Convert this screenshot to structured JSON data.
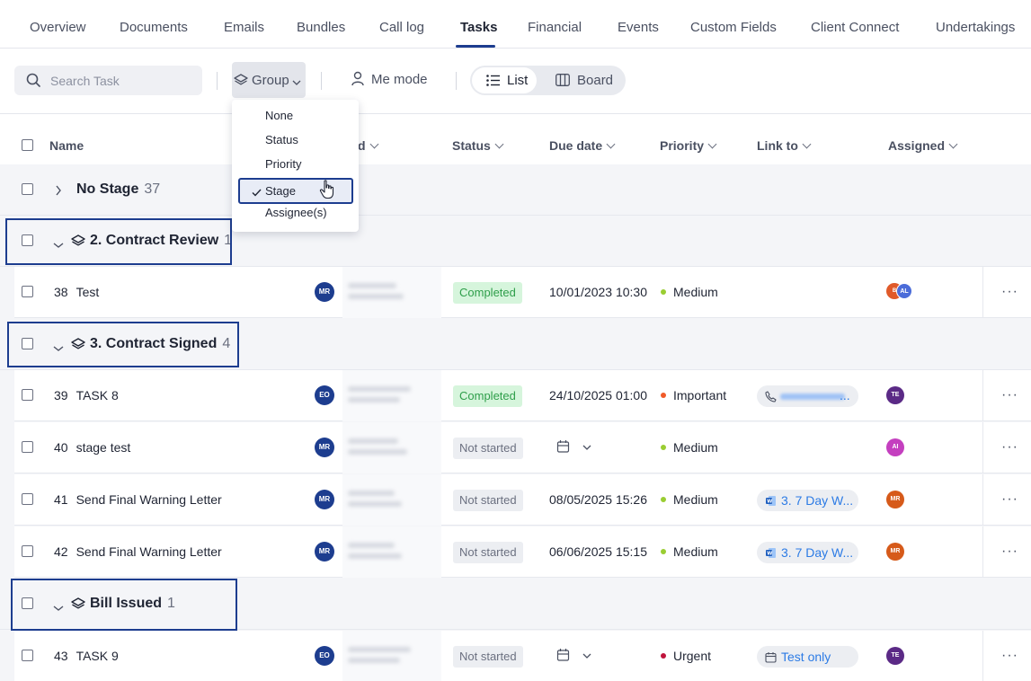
{
  "tabs": [
    "Overview",
    "Documents",
    "Emails",
    "Bundles",
    "Call log",
    "Tasks",
    "Financial",
    "Events",
    "Custom Fields",
    "Client Connect",
    "Undertakings"
  ],
  "active_tab": "Tasks",
  "toolbar": {
    "search_placeholder": "Search Task",
    "group_label": "Group",
    "me_mode_label": "Me mode",
    "list_label": "List",
    "board_label": "Board"
  },
  "columns": {
    "name": "Name",
    "assigned_by_partial": "d",
    "status": "Status",
    "due_date": "Due date",
    "priority": "Priority",
    "link_to": "Link to",
    "assigned": "Assigned"
  },
  "group_menu": {
    "options": [
      "None",
      "Status",
      "Priority",
      "Stage",
      "Assignee(s)"
    ],
    "selected": "Stage"
  },
  "groups": [
    {
      "name": "No Stage",
      "count": "37",
      "expanded": false
    },
    {
      "name": "2. Contract Review",
      "count": "1",
      "expanded": true
    },
    {
      "name": "3. Contract Signed",
      "count": "4",
      "expanded": true
    },
    {
      "name": "Bill Issued",
      "count": "1",
      "expanded": true
    }
  ],
  "tasks": [
    {
      "id": "38",
      "name": "Test",
      "owner": "MR",
      "status": "Completed",
      "due": "10/01/2023 10:30",
      "priority": "Medium",
      "link": "",
      "assigned": [
        "B",
        "AL"
      ]
    },
    {
      "id": "39",
      "name": "TASK 8",
      "owner": "EO",
      "status": "Completed",
      "due": "24/10/2025 01:00",
      "priority": "Important",
      "link": "",
      "assigned": [
        "TE"
      ]
    },
    {
      "id": "40",
      "name": "stage test",
      "owner": "MR",
      "status": "Not started",
      "due": "",
      "priority": "Medium",
      "link": "",
      "assigned": [
        "AI"
      ]
    },
    {
      "id": "41",
      "name": "Send Final Warning Letter",
      "owner": "MR",
      "status": "Not started",
      "due": "08/05/2025 15:26",
      "priority": "Medium",
      "link": "3. 7 Day W...",
      "assigned": [
        "MR"
      ]
    },
    {
      "id": "42",
      "name": "Send Final Warning Letter",
      "owner": "MR",
      "status": "Not started",
      "due": "06/06/2025 15:15",
      "priority": "Medium",
      "link": "3. 7 Day W...",
      "assigned": [
        "MR"
      ]
    },
    {
      "id": "43",
      "name": "TASK 9",
      "owner": "EO",
      "status": "Not started",
      "due": "",
      "priority": "Urgent",
      "link": "Test only",
      "assigned": [
        "TE"
      ]
    }
  ],
  "colors": {
    "accent": "#1d3d8f",
    "completed_bg": "#d6f5dc",
    "completed_text": "#2e9e4a",
    "medium": "#9acd32",
    "important": "#f05a28",
    "urgent": "#c0143c",
    "link": "#2c7be5"
  }
}
